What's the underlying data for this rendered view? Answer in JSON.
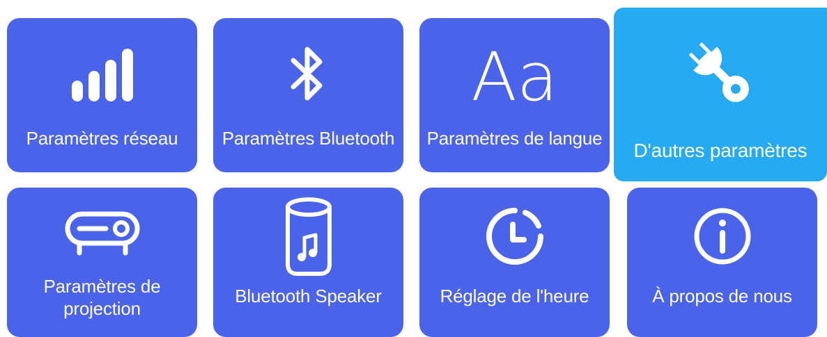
{
  "tiles": [
    {
      "label": "Paramètres réseau",
      "icon": "signal-bars-icon"
    },
    {
      "label": "Paramètres Bluetooth",
      "icon": "bluetooth-icon"
    },
    {
      "label": "Paramètres de langue",
      "icon": "language-icon",
      "icon_text": "Aa"
    },
    {
      "label": "D'autres paramètres",
      "icon": "wrench-icon",
      "selected": true
    },
    {
      "label": "Paramètres de projection",
      "icon": "projector-icon"
    },
    {
      "label": "Bluetooth Speaker",
      "icon": "speaker-icon"
    },
    {
      "label": "Réglage de l'heure",
      "icon": "clock-icon"
    },
    {
      "label": "À propos de nous",
      "icon": "info-icon"
    }
  ],
  "colors": {
    "tile": "#4a63e8",
    "tile_selected": "#26aaf2",
    "foreground": "#ffffff"
  }
}
